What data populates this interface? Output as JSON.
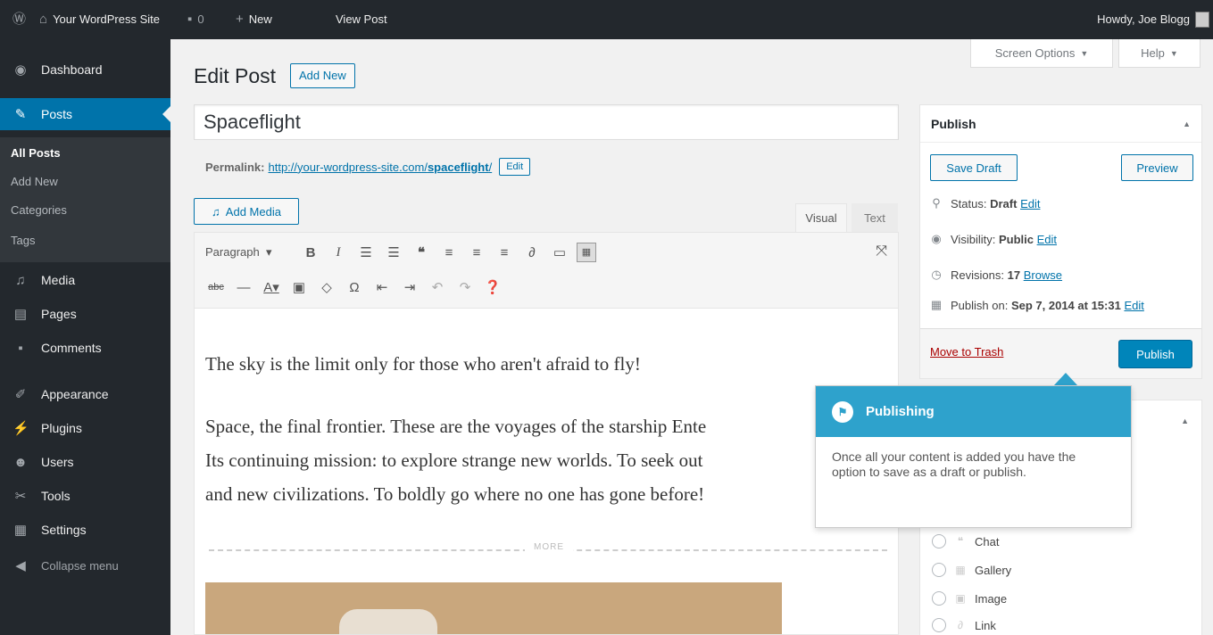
{
  "admin_bar": {
    "wp_icon": "wordpress-logo-icon",
    "site_name": "Your WordPress Site",
    "comments_count": "0",
    "new_label": "New",
    "view_post_label": "View Post",
    "howdy": "Howdy, Joe Blogg"
  },
  "sidebar": {
    "items": [
      {
        "label": "Dashboard",
        "icon": "dashboard-icon"
      },
      {
        "label": "Posts",
        "icon": "pin-icon"
      },
      {
        "label": "Media",
        "icon": "media-icon"
      },
      {
        "label": "Pages",
        "icon": "pages-icon"
      },
      {
        "label": "Comments",
        "icon": "comment-icon"
      },
      {
        "label": "Appearance",
        "icon": "brush-icon"
      },
      {
        "label": "Plugins",
        "icon": "plug-icon"
      },
      {
        "label": "Users",
        "icon": "users-icon"
      },
      {
        "label": "Tools",
        "icon": "wrench-icon"
      },
      {
        "label": "Settings",
        "icon": "settings-icon"
      },
      {
        "label": "Collapse menu",
        "icon": "collapse-icon"
      }
    ],
    "posts_submenu": [
      "All Posts",
      "Add New",
      "Categories",
      "Tags"
    ]
  },
  "header": {
    "screen_options": "Screen Options",
    "help": "Help",
    "title": "Edit Post",
    "add_new": "Add New"
  },
  "editor": {
    "post_title": "Spaceflight",
    "permalink_label": "Permalink:",
    "permalink_base": "http://your-wordpress-site.com/",
    "permalink_slug": "spaceflight",
    "permalink_edit": "Edit",
    "add_media": "Add Media",
    "tab_visual": "Visual",
    "tab_text": "Text",
    "format_select": "Paragraph",
    "paragraphs": [
      "The sky is the limit only for those who aren't afraid to fly!",
      "Space, the final frontier. These are the voyages of the starship Ente",
      "Its continuing mission: to explore strange new worlds. To seek out",
      "and new civilizations. To boldly go where no one has gone before!"
    ],
    "more_label": "MORE"
  },
  "publish": {
    "title": "Publish",
    "save_draft": "Save Draft",
    "preview": "Preview",
    "status_label": "Status:",
    "status_value": "Draft",
    "visibility_label": "Visibility:",
    "visibility_value": "Public",
    "revisions_label": "Revisions:",
    "revisions_value": "17",
    "browse": "Browse",
    "publish_on_label": "Publish on:",
    "publish_on_value": "Sep 7, 2014 at 15:31",
    "edit": "Edit",
    "move_to_trash": "Move to Trash",
    "publish_button": "Publish"
  },
  "format": {
    "options": [
      "Chat",
      "Gallery",
      "Image",
      "Link"
    ]
  },
  "pointer": {
    "title": "Publishing",
    "body": "Once all your content is added you have the option to save as a draft or publish.",
    "color": "#2ea2cc"
  },
  "colors": {
    "admin_dark": "#23282d",
    "accent": "#0073aa",
    "publish_button": "#0085ba",
    "trash": "#a00"
  }
}
